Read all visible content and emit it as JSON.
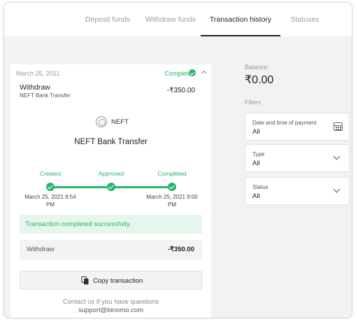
{
  "tabs": [
    {
      "label": "Deposit funds",
      "active": false
    },
    {
      "label": "Withdraw funds",
      "active": false
    },
    {
      "label": "Transaction history",
      "active": true
    },
    {
      "label": "Statuses",
      "active": false
    }
  ],
  "transaction": {
    "date": "March 25, 2021",
    "status": "Complete",
    "type": "Withdraw",
    "method_small": "NEFT Bank Transfer",
    "amount": "-₹350.00",
    "provider_logo_text": "NEFT",
    "method_title": "NEFT Bank Transfer",
    "timeline": [
      {
        "label": "Created",
        "time_line1": "March 25, 2021 8:54",
        "time_line2": "PM"
      },
      {
        "label": "Approved"
      },
      {
        "label": "Completed",
        "time_line1": "March 25, 2021 9:00",
        "time_line2": "PM"
      }
    ],
    "success_message": "Transaction completed successfully.",
    "summary_label": "Withdraw",
    "summary_amount": "-₹350.00",
    "copy_button_label": "Copy transaction",
    "contact_line1": "Contact us if you have questions",
    "contact_line2": "support@binomo.com"
  },
  "balance": {
    "label": "Balance:",
    "value": "₹0.00"
  },
  "filters": {
    "label": "Filters",
    "items": [
      {
        "label": "Date and time of payment",
        "value": "All",
        "icon": "calendar-icon"
      },
      {
        "label": "Type",
        "value": "All",
        "icon": "chevron-down-icon"
      },
      {
        "label": "Status",
        "value": "All",
        "icon": "chevron-down-icon"
      }
    ]
  },
  "colors": {
    "accent_green": "#2bb36a",
    "success_bg": "#e7f6ec",
    "background": "#f2f2f2"
  }
}
